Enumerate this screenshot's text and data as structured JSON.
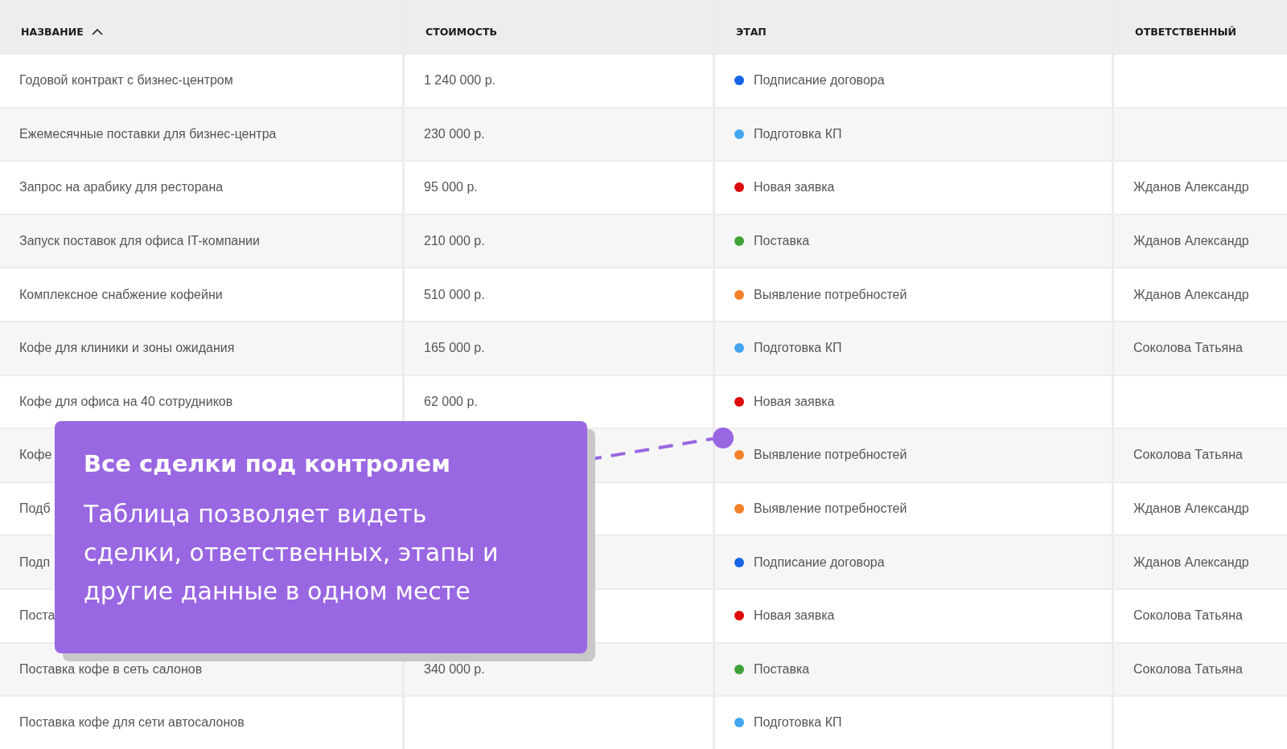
{
  "table": {
    "columns": [
      {
        "label": "НАЗВАНИЕ",
        "sorted": true
      },
      {
        "label": "СТОИМОСТЬ",
        "sorted": false
      },
      {
        "label": "ЭТАП",
        "sorted": false
      },
      {
        "label": "ОТВЕТСТВЕННЫЙ",
        "sorted": false
      }
    ],
    "rows": [
      {
        "name": "Годовой контракт с бизнес-центром",
        "cost": "1 240 000 р.",
        "stage": {
          "label": "Подписание договора",
          "color": "#1565e8"
        }
      },
      {
        "name": "Ежемесячные поставки для бизнес-центра",
        "cost": "230 000 р.",
        "stage": {
          "label": "Подготовка КП",
          "color": "#42a5f0"
        }
      },
      {
        "name": "Запрос на арабику для ресторана",
        "cost": "95 000 р.",
        "stage": {
          "label": "Новая заявка",
          "color": "#dd0a0a"
        },
        "owner": "Жданов Александр"
      },
      {
        "name": "Запуск поставок для офиса IT-компании",
        "cost": "210 000 р.",
        "stage": {
          "label": "Поставка",
          "color": "#3ea33a"
        },
        "owner": "Жданов Александр"
      },
      {
        "name": "Комплексное снабжение кофейни",
        "cost": "510 000 р.",
        "stage": {
          "label": "Выявление потребностей",
          "color": "#f5802a"
        },
        "owner": "Жданов Александр"
      },
      {
        "name": "Кофе для клиники и зоны ожидания",
        "cost": "165 000 р.",
        "stage": {
          "label": "Подготовка КП",
          "color": "#42a5f0"
        },
        "owner": "Соколова Татьяна"
      },
      {
        "name": "Кофе для офиса на 40 сотрудников",
        "cost": "62 000 р.",
        "stage": {
          "label": "Новая заявка",
          "color": "#dd0a0a"
        }
      },
      {
        "name": "Кофе",
        "stage": {
          "label": "Выявление потребностей",
          "color": "#f5802a"
        },
        "owner": "Соколова Татьяна"
      },
      {
        "name": "Подб",
        "stage": {
          "label": "Выявление потребностей",
          "color": "#f5802a"
        },
        "owner": "Жданов Александр"
      },
      {
        "name": "Подп",
        "stage": {
          "label": "Подписание договора",
          "color": "#1565e8"
        },
        "owner": "Жданов Александр"
      },
      {
        "name": "Поста",
        "stage": {
          "label": "Новая заявка",
          "color": "#dd0a0a"
        },
        "owner": "Соколова Татьяна"
      },
      {
        "name": "Поставка кофе в сеть салонов",
        "cost": "340 000 р.",
        "stage": {
          "label": "Поставка",
          "color": "#3ea33a"
        },
        "owner": "Соколова Татьяна"
      },
      {
        "name": "Поставка кофе для сети автосалонов",
        "stage": {
          "label": "Подготовка КП",
          "color": "#42a5f0"
        }
      }
    ]
  },
  "callout": {
    "title": "Все сделки под контролем",
    "text": "Таблица позволяет видеть сделки, ответственных, этапы и другие данные в одном месте"
  }
}
